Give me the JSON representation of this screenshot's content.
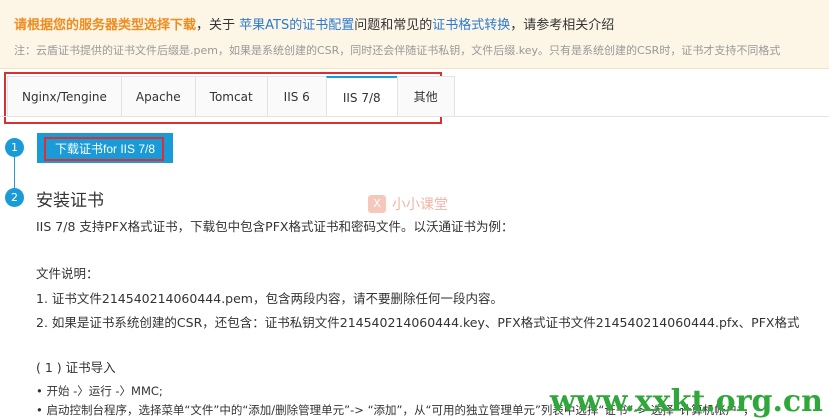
{
  "notice": {
    "lead": "请根据您的服务器类型选择下载",
    "mid1": "，关于",
    "link1": "苹果ATS的证书配置",
    "mid2": "问题和常见的",
    "link2": "证书格式转换",
    "tail": "，请参考相关介绍",
    "note": "注：云盾证书提供的证书文件后缀是.pem，如果是系统创建的CSR，同时还会伴随证书私钥，文件后缀.key。只有是系统创建的CSR时，证书才支持不同格式"
  },
  "tabs": [
    "Nginx/Tengine",
    "Apache",
    "Tomcat",
    "IIS 6",
    "IIS 7/8",
    "其他"
  ],
  "steps": [
    "1",
    "2"
  ],
  "download_button": "下载证书for IIS 7/8",
  "section_title": "安装证书",
  "watermark_text": "小小课堂",
  "watermark_logo": "X",
  "content": {
    "intro": "IIS 7/8 支持PFX格式证书，下载包中包含PFX格式证书和密码文件。以沃通证书为例：",
    "file_desc": "文件说明：",
    "item1": "1. 证书文件214540214060444.pem，包含两段内容，请不要删除任何一段内容。",
    "item2": "2. 如果是证书系统创建的CSR，还包含：证书私钥文件214540214060444.key、PFX格式证书文件214540214060444.pfx、PFX格式",
    "sub_title": "( 1 ) 证书导入",
    "bullet1": "• 开始 -〉运行 -〉MMC;",
    "bullet2": "• 启动控制台程序，选择菜单“文件”中的“添加/删除管理单元”-> “添加”，从“可用的独立管理单元”列表中选择“证书”-> 选择“计算机帐户”，"
  },
  "site_watermark": "www.xxkt.org.cn"
}
